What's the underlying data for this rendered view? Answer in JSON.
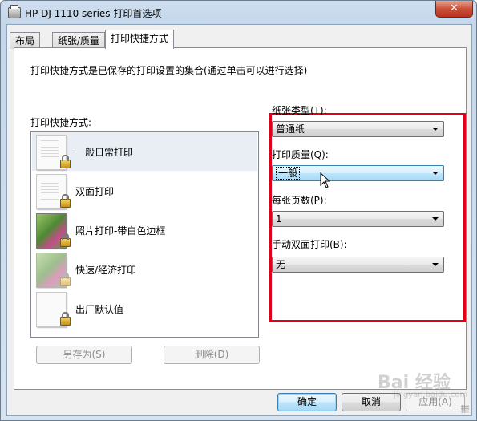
{
  "window": {
    "title": "HP DJ 1110 series 打印首选项",
    "close_glyph": "✕"
  },
  "tabs": [
    {
      "label": "布局"
    },
    {
      "label": "纸张/质量"
    },
    {
      "label": "打印快捷方式",
      "active": true
    }
  ],
  "panel": {
    "description": "打印快捷方式是已保存的打印设置的集合(通过单击可以进行选择)",
    "list_label": "打印快捷方式:",
    "shortcuts": [
      {
        "label": "一般日常打印",
        "icon": "document-icon",
        "selected": true
      },
      {
        "label": "双面打印",
        "icon": "duplex-document-icon"
      },
      {
        "label": "照片打印-带白色边框",
        "icon": "photo-icon"
      },
      {
        "label": "快速/经济打印",
        "icon": "faded-photo-icon"
      },
      {
        "label": "出厂默认值",
        "icon": "blank-page-icon"
      }
    ],
    "save_as_button": "另存为(S)",
    "delete_button": "删除(D)"
  },
  "settings": {
    "paper_type": {
      "label": "纸张类型(T):",
      "value": "普通纸"
    },
    "print_quality": {
      "label": "打印质量(Q):",
      "value": "一般"
    },
    "pages_per_sheet": {
      "label": "每张页数(P):",
      "value": "1"
    },
    "manual_duplex": {
      "label": "手动双面打印(B):",
      "value": "无"
    }
  },
  "footer": {
    "ok": "确定",
    "cancel": "取消",
    "apply": "应用(A)"
  },
  "watermark": {
    "text": "Bai 经验",
    "sub": "jingyan.baidu.com"
  },
  "colors": {
    "highlight_box": "#e0001b"
  }
}
